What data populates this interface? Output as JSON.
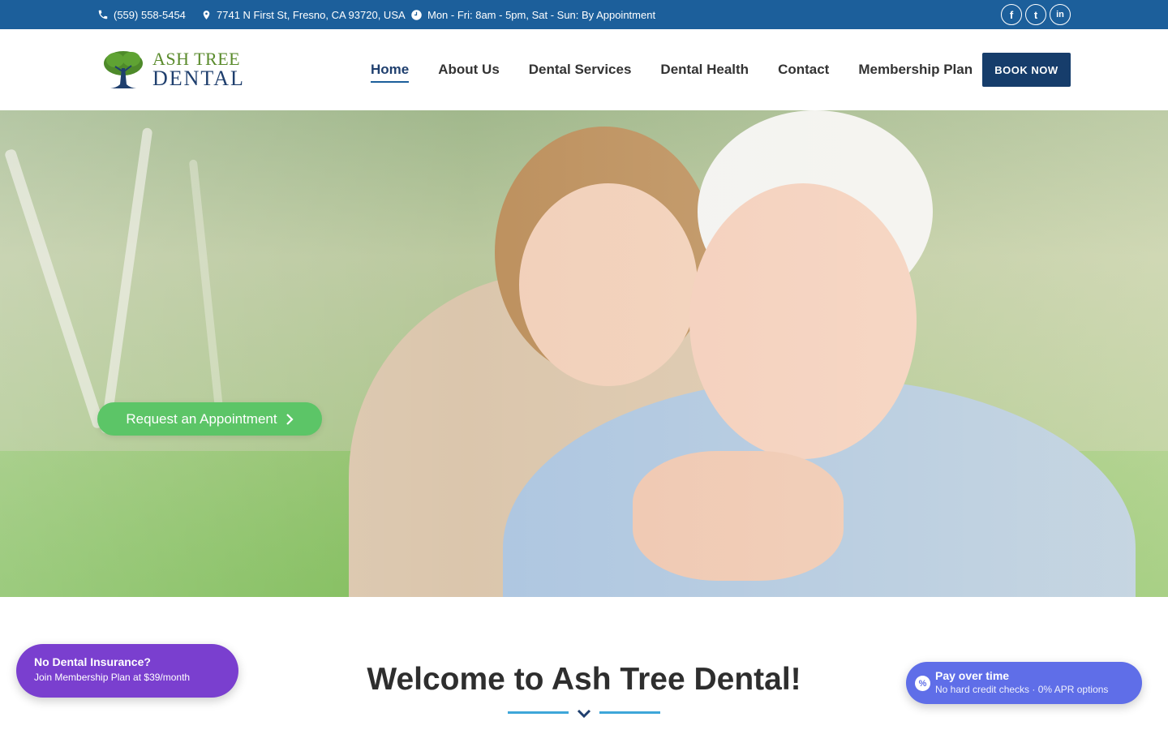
{
  "topbar": {
    "phone": "(559) 558-5454",
    "address": "7741 N First St, Fresno, CA 93720, USA",
    "hours": "Mon - Fri: 8am - 5pm, Sat - Sun: By Appointment",
    "social": [
      {
        "icon": "facebook-icon",
        "glyph": "f"
      },
      {
        "icon": "twitter-icon",
        "glyph": "t"
      },
      {
        "icon": "linkedin-icon",
        "glyph": "in"
      }
    ],
    "color": "#1c5f9b"
  },
  "header": {
    "logo_line1": "ASH TREE",
    "logo_line2": "DENTAL",
    "nav": [
      {
        "label": "Home",
        "active": true
      },
      {
        "label": "About Us",
        "active": false
      },
      {
        "label": "Dental Services",
        "active": false
      },
      {
        "label": "Dental Health",
        "active": false
      },
      {
        "label": "Contact",
        "active": false
      },
      {
        "label": "Membership Plan",
        "active": false
      }
    ],
    "book_label": "BOOK NOW",
    "book_color": "#163d6b"
  },
  "hero": {
    "cta_label": "Request an Appointment",
    "cta_color": "#5cc567"
  },
  "welcome": {
    "title": "Welcome to Ash Tree Dental!"
  },
  "promo_left": {
    "title": "No Dental Insurance?",
    "subtitle": "Join Membership Plan at $39/month",
    "color": "#7a3fcf"
  },
  "promo_right": {
    "title": "Pay over time",
    "subtitle": "No hard credit checks · 0% APR options",
    "badge": "%",
    "color": "#5f6ee8"
  }
}
